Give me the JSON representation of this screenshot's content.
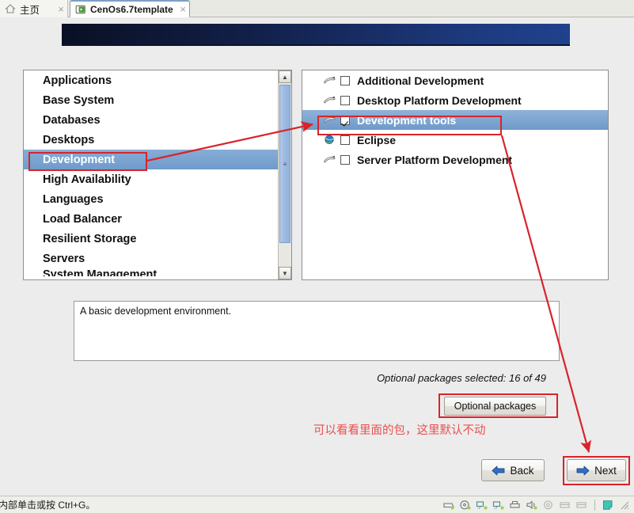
{
  "window": {
    "tabs": [
      {
        "label": "主页",
        "icon": "home-icon",
        "active": false
      },
      {
        "label": "CenOs6.7template",
        "icon": "vm-play-icon",
        "active": true
      }
    ],
    "close_glyph": "×"
  },
  "installer": {
    "group_list": {
      "items": [
        {
          "label": "Applications",
          "selected": false
        },
        {
          "label": "Base System",
          "selected": false
        },
        {
          "label": "Databases",
          "selected": false
        },
        {
          "label": "Desktops",
          "selected": false
        },
        {
          "label": "Development",
          "selected": true
        },
        {
          "label": "High Availability",
          "selected": false
        },
        {
          "label": "Languages",
          "selected": false
        },
        {
          "label": "Load Balancer",
          "selected": false
        },
        {
          "label": "Resilient Storage",
          "selected": false
        },
        {
          "label": "Servers",
          "selected": false
        },
        {
          "label": "System Management",
          "selected": false
        }
      ]
    },
    "package_list": {
      "items": [
        {
          "label": "Additional Development",
          "checked": false,
          "selected": false,
          "icon": "package-group-icon"
        },
        {
          "label": "Desktop Platform Development",
          "checked": false,
          "selected": false,
          "icon": "package-group-icon"
        },
        {
          "label": "Development tools",
          "checked": true,
          "selected": true,
          "icon": "package-group-icon"
        },
        {
          "label": "Eclipse",
          "checked": false,
          "selected": false,
          "icon": "globe-package-icon"
        },
        {
          "label": "Server Platform Development",
          "checked": false,
          "selected": false,
          "icon": "package-group-icon"
        }
      ]
    },
    "description": "A basic development environment.",
    "optional_count_text": "Optional packages selected: 16 of 49",
    "optional_packages_button": "Optional packages",
    "annotation_note": "可以看看里面的包，这里默认不动",
    "back_button": "Back",
    "next_button": "Next"
  },
  "statusbar": {
    "text": "内部单击或按 Ctrl+G。",
    "icons": [
      "harddisk-icon",
      "cdrom-icon",
      "network-adapter-icon",
      "network-adapter-2-icon",
      "printer-icon",
      "sound-icon",
      "usb-icon",
      "removable-device-icon",
      "removable-device-2-icon"
    ]
  },
  "colors": {
    "annotation_red": "#d9232a",
    "annotation_text_red": "#e8504f",
    "selection_blue": "#7ba4d1",
    "banner_dark": "#0a1024",
    "banner_light": "#20418c"
  }
}
